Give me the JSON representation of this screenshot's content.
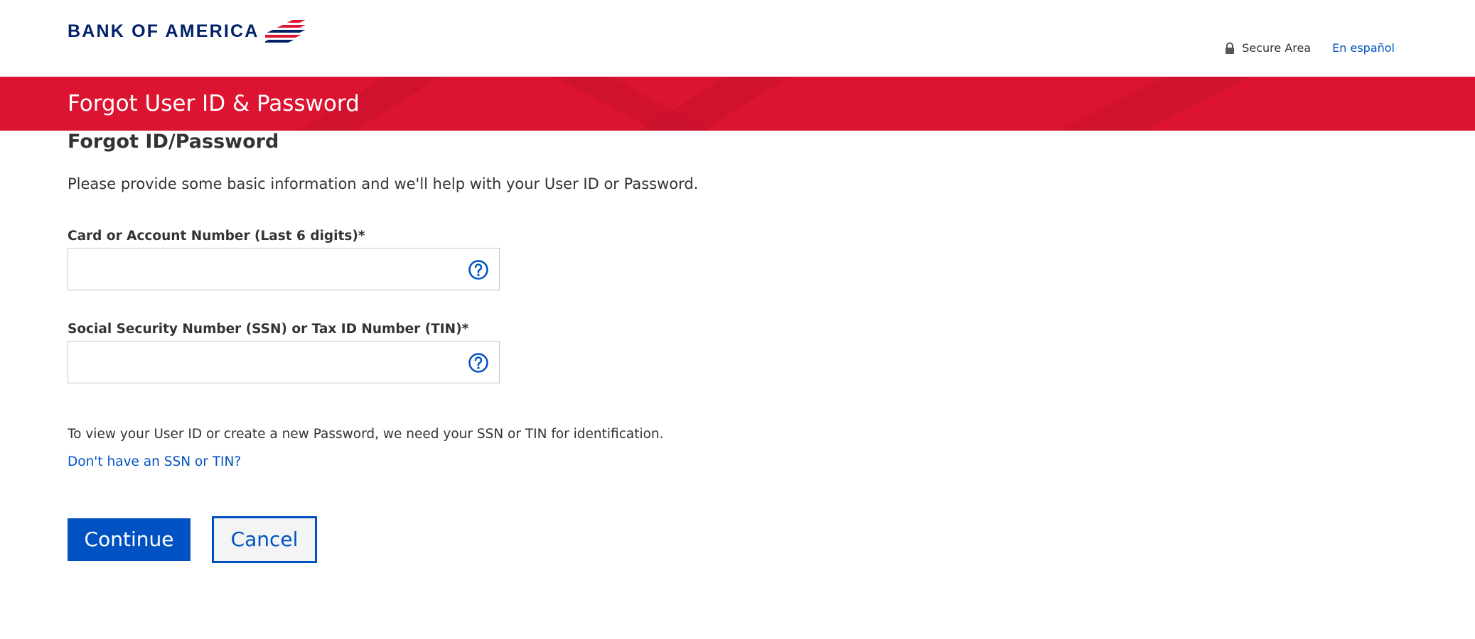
{
  "header": {
    "logo_text": "BANK OF AMERICA",
    "logo_icon": "bank-flag-logo",
    "secure_icon": "lock-icon",
    "secure_label": "Secure Area",
    "language_link": "En español"
  },
  "banner": {
    "title": "Forgot User ID & Password"
  },
  "main": {
    "heading": "Forgot ID/Password",
    "intro": "Please provide some basic information and we'll help with your User ID or Password.",
    "fields": [
      {
        "label": "Card or Account Number (Last 6 digits)*",
        "value": "",
        "help_icon": "question-circle-icon"
      },
      {
        "label": "Social Security Number (SSN) or Tax ID Number (TIN)*",
        "value": "",
        "help_icon": "question-circle-icon"
      }
    ],
    "note": "To view your User ID or create a new Password, we need your SSN or TIN for identification.",
    "no_ssn_link": "Don't have an SSN or TIN?",
    "continue_label": "Continue",
    "cancel_label": "Cancel"
  },
  "colors": {
    "brand_navy": "#012169",
    "brand_red": "#dc1431",
    "link_blue": "#0052c2"
  }
}
